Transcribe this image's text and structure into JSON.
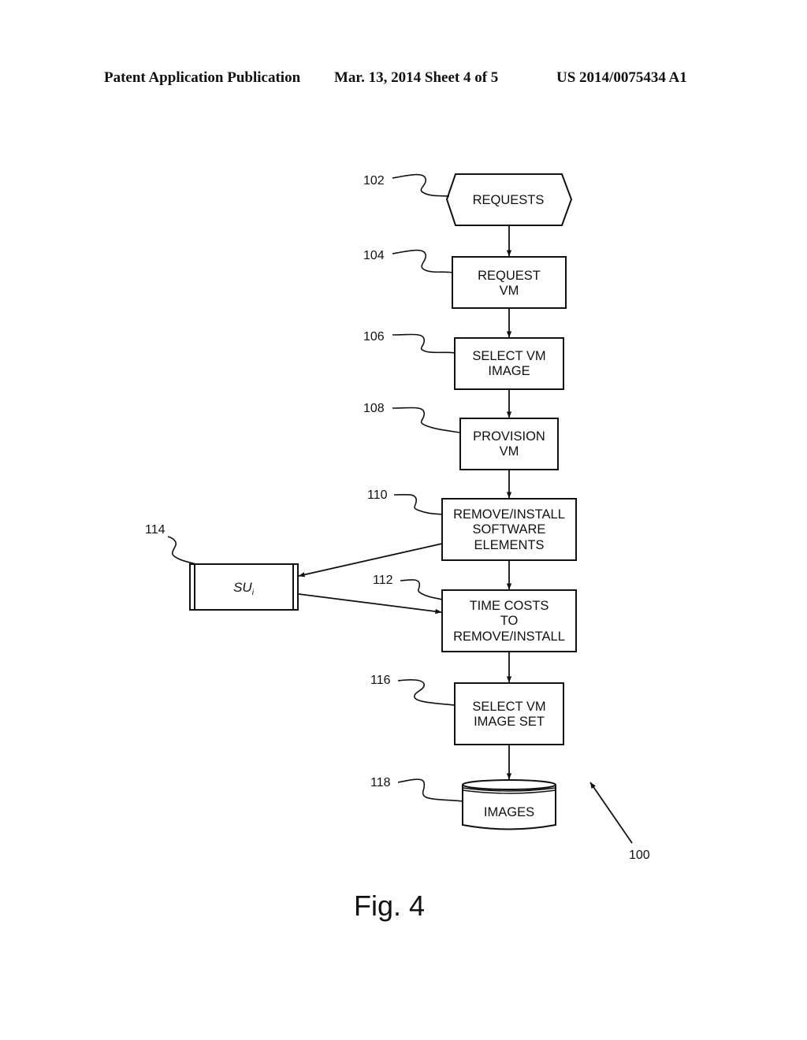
{
  "header": {
    "left": "Patent Application Publication",
    "middle": "Mar. 13, 2014  Sheet 4 of 5",
    "right": "US 2014/0075434 A1"
  },
  "figure": {
    "label": "Fig. 4",
    "overall_ref": "100",
    "nodes": [
      {
        "id": "102",
        "shape": "hexagon",
        "lines": [
          "REQUESTS"
        ]
      },
      {
        "id": "104",
        "shape": "rectangle",
        "lines": [
          "REQUEST",
          "VM"
        ]
      },
      {
        "id": "106",
        "shape": "rectangle",
        "lines": [
          "SELECT VM",
          "IMAGE"
        ]
      },
      {
        "id": "108",
        "shape": "rectangle",
        "lines": [
          "PROVISION",
          "VM"
        ]
      },
      {
        "id": "110",
        "shape": "rectangle",
        "lines": [
          "REMOVE/INSTALL",
          "SOFTWARE",
          "ELEMENTS"
        ]
      },
      {
        "id": "112",
        "shape": "rectangle",
        "lines": [
          "TIME COSTS",
          "TO",
          "REMOVE/INSTALL"
        ]
      },
      {
        "id": "114",
        "shape": "predefined-process",
        "label": "SU",
        "subscript": "i"
      },
      {
        "id": "116",
        "shape": "rectangle",
        "lines": [
          "SELECT VM",
          "IMAGE SET"
        ]
      },
      {
        "id": "118",
        "shape": "database",
        "lines": [
          "IMAGES"
        ]
      }
    ],
    "edges": [
      {
        "from": "102",
        "to": "104"
      },
      {
        "from": "104",
        "to": "106"
      },
      {
        "from": "106",
        "to": "108"
      },
      {
        "from": "108",
        "to": "110"
      },
      {
        "from": "110",
        "to": "112"
      },
      {
        "from": "110",
        "to": "114"
      },
      {
        "from": "114",
        "to": "112"
      },
      {
        "from": "112",
        "to": "116"
      },
      {
        "from": "116",
        "to": "118"
      }
    ]
  }
}
